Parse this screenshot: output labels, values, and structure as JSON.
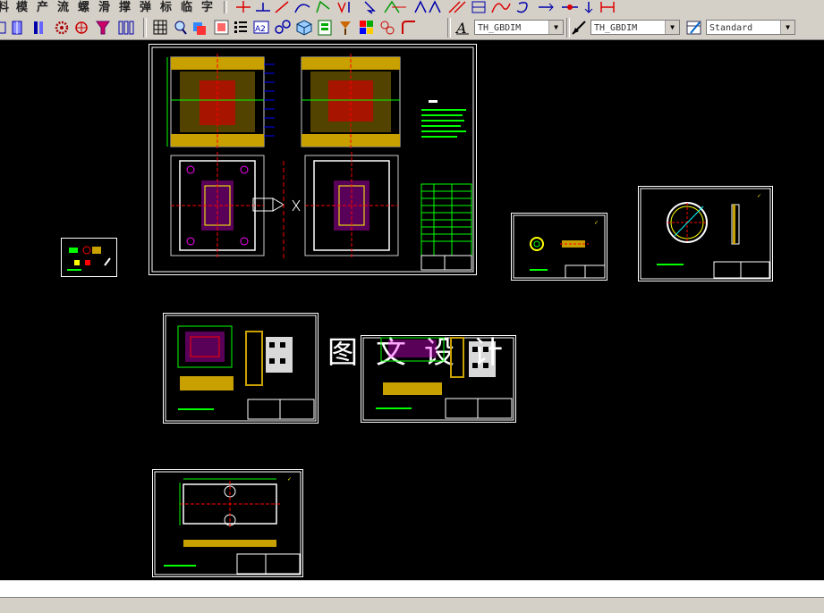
{
  "menu_row": {
    "labels": [
      "料",
      "模",
      "产",
      "流",
      "螺",
      "滑",
      "撑",
      "弹",
      "标",
      "临",
      "字"
    ]
  },
  "toolbar": {
    "text_style_value": "TH_GBDIM",
    "dim_style_value": "TH_GBDIM",
    "table_style_value": "Standard"
  },
  "canvas": {
    "watermark": "图文设计"
  }
}
